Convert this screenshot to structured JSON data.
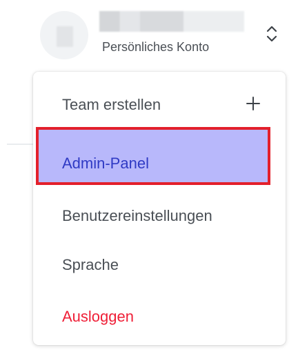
{
  "account": {
    "type_label": "Persönliches Konto",
    "icons": {
      "avatar": "avatar-placeholder",
      "toggle": "chevron-up-down-icon"
    }
  },
  "menu": {
    "items": [
      {
        "label": "Team erstellen",
        "icon": "plus-icon"
      },
      {
        "label": "Admin-Panel",
        "highlighted": true
      },
      {
        "label": "Benutzereinstellungen"
      },
      {
        "label": "Sprache"
      },
      {
        "label": "Ausloggen",
        "color": "#ef1f37"
      }
    ]
  },
  "colors": {
    "highlight_fill": "#a0a0fa",
    "highlight_border": "#e3202b",
    "text": "#4a4f55",
    "admin_text": "#2f3ac4",
    "danger": "#ef1f37"
  }
}
